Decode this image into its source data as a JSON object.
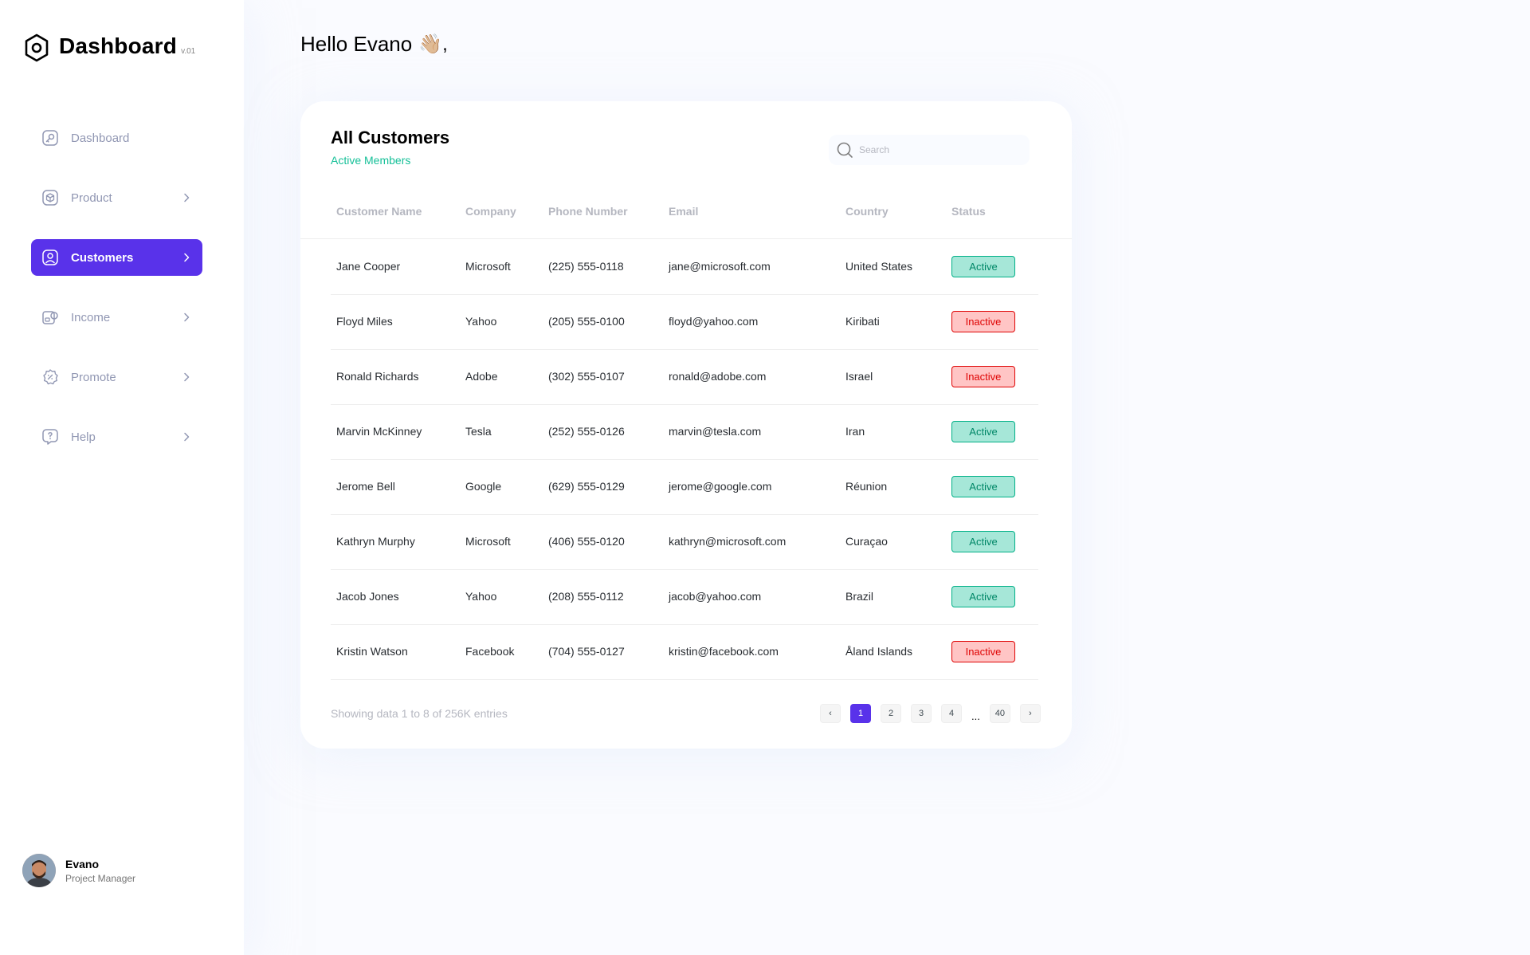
{
  "brand": {
    "title": "Dashboard",
    "version": "v.01"
  },
  "nav": [
    {
      "label": "Dashboard",
      "icon": "key-square-icon",
      "active": false,
      "chevron": false
    },
    {
      "label": "Product",
      "icon": "cube-icon",
      "active": false,
      "chevron": true
    },
    {
      "label": "Customers",
      "icon": "user-square-icon",
      "active": true,
      "chevron": true
    },
    {
      "label": "Income",
      "icon": "wallet-money-icon",
      "active": false,
      "chevron": true
    },
    {
      "label": "Promote",
      "icon": "discount-shape-icon",
      "active": false,
      "chevron": true
    },
    {
      "label": "Help",
      "icon": "message-question-icon",
      "active": false,
      "chevron": true
    }
  ],
  "profile": {
    "name": "Evano",
    "role": "Project Manager"
  },
  "greeting": {
    "text": "Hello Evano",
    "emoji": "👋🏼,"
  },
  "card": {
    "title": "All Customers",
    "subtitle": "Active Members"
  },
  "search": {
    "placeholder": "Search",
    "value": ""
  },
  "table": {
    "headers": [
      "Customer Name",
      "Company",
      "Phone Number",
      "Email",
      "Country",
      "Status"
    ],
    "rows": [
      {
        "name": "Jane Cooper",
        "company": "Microsoft",
        "phone": "(225) 555-0118",
        "email": "jane@microsoft.com",
        "country": "United States",
        "status": "Active"
      },
      {
        "name": "Floyd Miles",
        "company": "Yahoo",
        "phone": "(205) 555-0100",
        "email": "floyd@yahoo.com",
        "country": "Kiribati",
        "status": "Inactive"
      },
      {
        "name": "Ronald Richards",
        "company": "Adobe",
        "phone": "(302) 555-0107",
        "email": "ronald@adobe.com",
        "country": "Israel",
        "status": "Inactive"
      },
      {
        "name": "Marvin McKinney",
        "company": "Tesla",
        "phone": "(252) 555-0126",
        "email": "marvin@tesla.com",
        "country": "Iran",
        "status": "Active"
      },
      {
        "name": "Jerome Bell",
        "company": "Google",
        "phone": "(629) 555-0129",
        "email": "jerome@google.com",
        "country": "Réunion",
        "status": "Active"
      },
      {
        "name": "Kathryn Murphy",
        "company": "Microsoft",
        "phone": "(406) 555-0120",
        "email": "kathryn@microsoft.com",
        "country": "Curaçao",
        "status": "Active"
      },
      {
        "name": "Jacob Jones",
        "company": "Yahoo",
        "phone": "(208) 555-0112",
        "email": "jacob@yahoo.com",
        "country": "Brazil",
        "status": "Active"
      },
      {
        "name": "Kristin Watson",
        "company": "Facebook",
        "phone": "(704) 555-0127",
        "email": "kristin@facebook.com",
        "country": "Åland Islands",
        "status": "Inactive"
      }
    ]
  },
  "footer": {
    "text": "Showing data 1 to 8 of 256K entries"
  },
  "pagination": {
    "prev": "‹",
    "pages": [
      "1",
      "2",
      "3",
      "4"
    ],
    "dots": "...",
    "last": "40",
    "next": "›",
    "current": "1"
  },
  "colors": {
    "accent": "#5932ea",
    "green": "#16c098",
    "active_bg": "#a6e7d8",
    "inactive_bg": "#ffc5c5"
  }
}
